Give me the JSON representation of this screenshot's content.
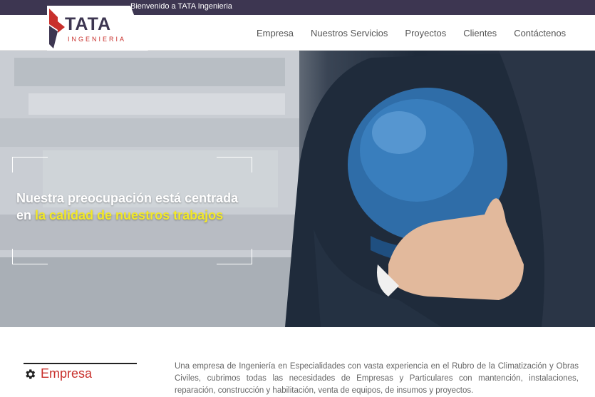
{
  "topbar": {
    "welcome": "Bienvenido a TATA Ingenieria"
  },
  "logo": {
    "title": "TATA",
    "subtitle": "INGENIERIA"
  },
  "nav": {
    "items": [
      {
        "label": "Empresa"
      },
      {
        "label": "Nuestros Servicios"
      },
      {
        "label": "Proyectos"
      },
      {
        "label": "Clientes"
      },
      {
        "label": "Contáctenos"
      }
    ]
  },
  "hero": {
    "line1": "Nuestra preocupación está centrada",
    "line2_prefix": "en ",
    "line2_highlight": "la calidad de nuestros trabajos"
  },
  "empresa": {
    "title": "Empresa",
    "body": "Una empresa de Ingeniería en Especialidades con vasta experiencia en el Rubro de la Climatización y Obras Civiles, cubrimos todas las necesidades de Empresas y Particulares con mantención, instalaciones, reparación, construcción y habilitación, venta de equipos, de insumos y proyectos."
  },
  "icons": {
    "section": "gear-icon"
  },
  "colors": {
    "topbar": "#3d3651",
    "brand_red": "#c8302c",
    "highlight": "#f2e82a"
  }
}
